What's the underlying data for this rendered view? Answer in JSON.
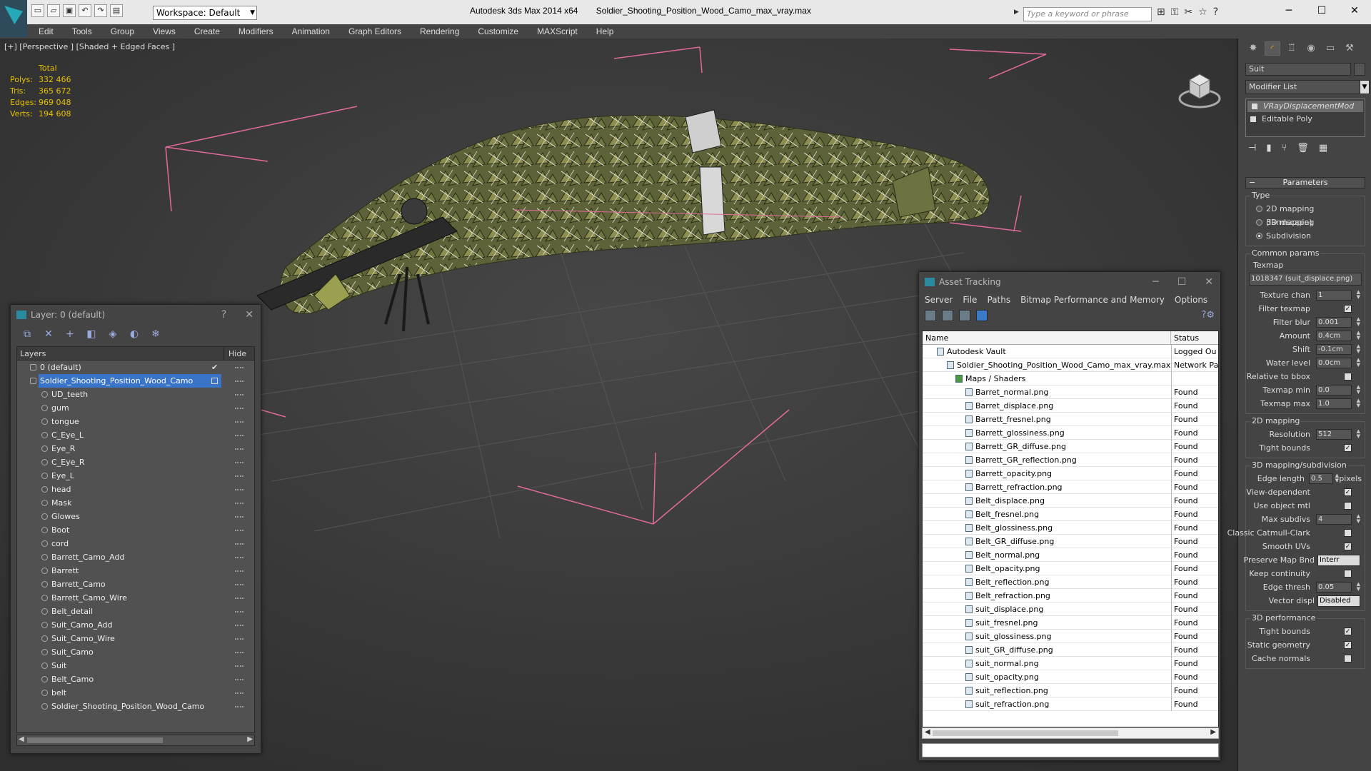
{
  "titlebar": {
    "app_name": "Autodesk 3ds Max  2014 x64",
    "file_name": "Soldier_Shooting_Position_Wood_Camo_max_vray.max",
    "workspace": "Workspace: Default",
    "search_placeholder": "Type a keyword or phrase"
  },
  "menubar": {
    "items": [
      "Edit",
      "Tools",
      "Group",
      "Views",
      "Create",
      "Modifiers",
      "Animation",
      "Graph Editors",
      "Rendering",
      "Customize",
      "MAXScript",
      "Help"
    ]
  },
  "viewport": {
    "label": "[+] [Perspective ] [Shaded + Edged Faces ]",
    "stats": {
      "total_label": "Total",
      "rows": [
        {
          "k": "Polys:",
          "v": "332 466"
        },
        {
          "k": "Tris:",
          "v": "365 672"
        },
        {
          "k": "Edges:",
          "v": "969 048"
        },
        {
          "k": "Verts:",
          "v": "194 608"
        }
      ]
    }
  },
  "layer_window": {
    "title": "Layer: 0 (default)",
    "help": "?",
    "close": "✕",
    "col_layers": "Layers",
    "col_hide": "Hide",
    "default_layer": "0 (default)",
    "selected_layer": "Soldier_Shooting_Position_Wood_Camo",
    "objects": [
      "UD_teeth",
      "gum",
      "tongue",
      "C_Eye_L",
      "Eye_R",
      "C_Eye_R",
      "Eye_L",
      "head",
      "Mask",
      "Glowes",
      "Boot",
      "cord",
      "Barrett_Camo_Add",
      "Barrett",
      "Barrett_Camo",
      "Barrett_Camo_Wire",
      "Belt_detail",
      "Suit_Camo_Add",
      "Suit_Camo_Wire",
      "Suit_Camo",
      "Suit",
      "Belt_Camo",
      "belt",
      "Soldier_Shooting_Position_Wood_Camo"
    ]
  },
  "asset_window": {
    "title": "Asset Tracking",
    "menu": [
      "Server",
      "File",
      "Paths",
      "Bitmap Performance and Memory",
      "Options"
    ],
    "col_name": "Name",
    "col_status": "Status",
    "vault": {
      "name": "Autodesk Vault",
      "status": "Logged Ou"
    },
    "file": {
      "name": "Soldier_Shooting_Position_Wood_Camo_max_vray.max",
      "status": "Network Pa"
    },
    "maps_folder": "Maps / Shaders",
    "found_label": "Found",
    "maps": [
      "Barret_normal.png",
      "Barret_displace.png",
      "Barrett_fresnel.png",
      "Barrett_glossiness.png",
      "Barrett_GR_diffuse.png",
      "Barrett_GR_reflection.png",
      "Barrett_opacity.png",
      "Barrett_refraction.png",
      "Belt_displace.png",
      "Belt_fresnel.png",
      "Belt_glossiness.png",
      "Belt_GR_diffuse.png",
      "Belt_normal.png",
      "Belt_opacity.png",
      "Belt_reflection.png",
      "Belt_refraction.png",
      "suit_displace.png",
      "suit_fresnel.png",
      "suit_glossiness.png",
      "suit_GR_diffuse.png",
      "suit_normal.png",
      "suit_opacity.png",
      "suit_reflection.png",
      "suit_refraction.png"
    ]
  },
  "command_panel": {
    "object_name": "Suit",
    "modifier_list": "Modifier List",
    "stack": [
      "VRayDisplacementMod",
      "Editable Poly"
    ],
    "rollout": "Parameters",
    "type_group": "Type",
    "type_options": [
      {
        "label": "2D mapping (landscape)",
        "on": false
      },
      {
        "label": "3D mapping",
        "on": false
      },
      {
        "label": "Subdivision",
        "on": true
      }
    ],
    "common_group": "Common params",
    "texmap_label": "Texmap",
    "texmap_value": "1018347 (suit_displace.png)",
    "common_rows": [
      {
        "label": "Texture chan",
        "value": "1",
        "kind": "spin"
      },
      {
        "label": "Filter texmap",
        "value": "✓",
        "kind": "check"
      },
      {
        "label": "Filter blur",
        "value": "0.001",
        "kind": "spin"
      },
      {
        "label": "Amount",
        "value": "0.4cm",
        "kind": "spin"
      },
      {
        "label": "Shift",
        "value": "-0.1cm",
        "kind": "spin"
      },
      {
        "label": "Water level",
        "value": "0.0cm",
        "kind": "spin"
      },
      {
        "label": "Relative to bbox",
        "value": "",
        "kind": "check"
      },
      {
        "label": "Texmap min",
        "value": "0.0",
        "kind": "spin"
      },
      {
        "label": "Texmap max",
        "value": "1.0",
        "kind": "spin"
      }
    ],
    "map2d_group": "2D mapping",
    "map2d_rows": [
      {
        "label": "Resolution",
        "value": "512",
        "kind": "spin"
      },
      {
        "label": "Tight bounds",
        "value": "✓",
        "kind": "check"
      }
    ],
    "subdiv_group": "3D mapping/subdivision",
    "subdiv_rows": [
      {
        "label": "Edge length",
        "value": "0.5",
        "kind": "spin",
        "suffix": "pixels"
      },
      {
        "label": "View-dependent",
        "value": "✓",
        "kind": "check"
      },
      {
        "label": "Use object mtl",
        "value": "",
        "kind": "check"
      },
      {
        "label": "Max subdivs",
        "value": "4",
        "kind": "spin"
      },
      {
        "label": "Classic Catmull-Clark",
        "value": "",
        "kind": "check"
      },
      {
        "label": "Smooth UVs",
        "value": "✓",
        "kind": "check"
      },
      {
        "label": "Preserve Map Bnd",
        "value": "Interr",
        "kind": "dropdown"
      },
      {
        "label": "Keep continuity",
        "value": "",
        "kind": "check"
      },
      {
        "label": "Edge thresh",
        "value": "0.05",
        "kind": "spin"
      },
      {
        "label": "Vector displ",
        "value": "Disabled",
        "kind": "dropdown"
      }
    ],
    "perf_group": "3D performance",
    "perf_rows": [
      {
        "label": "Tight bounds",
        "value": "✓",
        "kind": "check"
      },
      {
        "label": "Static geometry",
        "value": "✓",
        "kind": "check"
      },
      {
        "label": "Cache normals",
        "value": "",
        "kind": "check"
      }
    ]
  }
}
